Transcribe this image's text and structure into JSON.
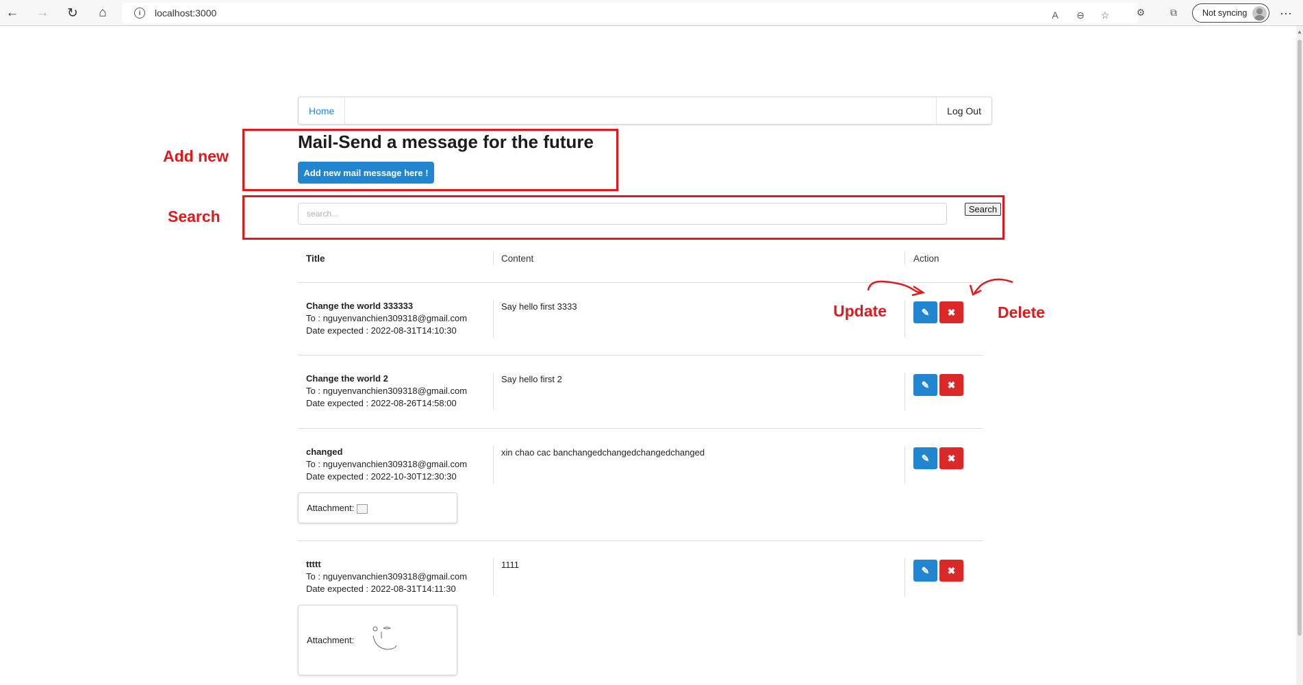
{
  "browser": {
    "url": "localhost:3000",
    "sync_label": "Not syncing",
    "back_glyph": "←",
    "forward_glyph": "→",
    "reload_glyph": "↻",
    "home_glyph": "⌂",
    "more_glyph": "···",
    "read_aloud_glyph": "A",
    "zoom_glyph": "⊖",
    "favorite_glyph": "☆",
    "extensions_glyph": "⚙",
    "collections_glyph": "⧉"
  },
  "nav": {
    "home_label": "Home",
    "logout_label": "Log Out"
  },
  "header": {
    "title": "Mail-Send a message for the future",
    "add_button_label": "Add new mail message here !"
  },
  "search": {
    "placeholder": "search...",
    "value": "",
    "button_label": "Search"
  },
  "table": {
    "headers": {
      "title": "Title",
      "content": "Content",
      "action": "Action"
    },
    "rows": [
      {
        "title": "Change the world 333333",
        "to": "To : nguyenvanchien309318@gmail.com",
        "date": "Date expected : 2022-08-31T14:10:30",
        "content": "Say hello first 3333"
      },
      {
        "title": "Change the world 2",
        "to": "To : nguyenvanchien309318@gmail.com",
        "date": "Date expected : 2022-08-26T14:58:00",
        "content": "Say hello first 2"
      },
      {
        "title": "changed",
        "to": "To : nguyenvanchien309318@gmail.com",
        "date": "Date expected : 2022-10-30T12:30:30",
        "content": "xin chao cac banchangedchangedchangedchanged",
        "attachment_label": "Attachment:"
      },
      {
        "title": "ttttt",
        "to": "To : nguyenvanchien309318@gmail.com",
        "date": "Date expected : 2022-08-31T14:11:30",
        "content": "1111",
        "attachment_label": "Attachment:"
      }
    ],
    "edit_icon": "pencil-icon",
    "delete_icon": "close-icon"
  },
  "annotations": {
    "add_new": "Add new",
    "search": "Search",
    "update": "Update",
    "delete": "Delete",
    "color": "#e0191f"
  },
  "colors": {
    "primary": "#2185d0",
    "danger": "#db2828"
  }
}
